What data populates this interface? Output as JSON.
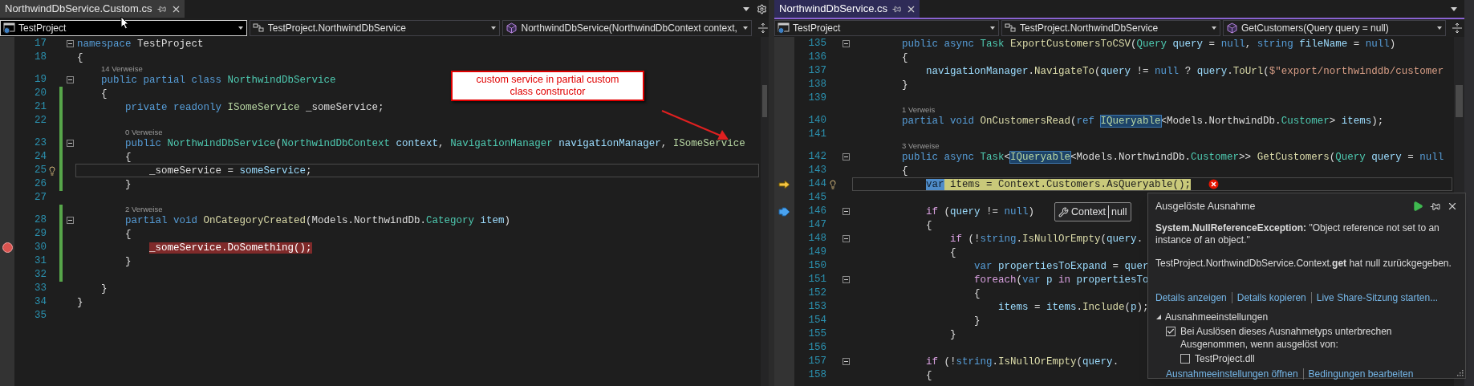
{
  "left_pane": {
    "tab": {
      "title": "NorthwindDbService.Custom.cs",
      "selected": false
    },
    "navigation": [
      {
        "label": "TestProject",
        "focused": true
      },
      {
        "label": "TestProject.NorthwindDbService",
        "focused": false
      },
      {
        "label": "NorthwindDbService(NorthwindDbContext context,",
        "focused": false
      }
    ],
    "annotation": {
      "text": "custom service in partial custom class constructor"
    },
    "lines": [
      {
        "kind": "code",
        "number": "17",
        "tokens": [
          {
            "text": "namespace",
            "kind": "kw"
          },
          {
            "text": " TestProject",
            "kind": "plain"
          }
        ],
        "changed": false,
        "fold": true,
        "caret_line": false
      },
      {
        "kind": "code",
        "number": "18",
        "tokens": [
          {
            "text": "{",
            "kind": "plain"
          }
        ],
        "changed": false,
        "fold": false,
        "caret_line": false
      },
      {
        "kind": "lens",
        "text": "14 Verweise",
        "changed": false
      },
      {
        "kind": "code",
        "number": "19",
        "tokens": [
          {
            "text": "    public partial class",
            "kind": "kw"
          },
          {
            "text": " NorthwindDbService",
            "kind": "type"
          }
        ],
        "changed": false,
        "fold": true,
        "caret_line": false
      },
      {
        "kind": "code",
        "number": "20",
        "tokens": [
          {
            "text": "    {",
            "kind": "plain"
          }
        ],
        "changed": true,
        "fold": false,
        "caret_line": false
      },
      {
        "kind": "code",
        "number": "21",
        "tokens": [
          {
            "text": "        private readonly",
            "kind": "kw"
          },
          {
            "text": " ISomeService",
            "kind": "iface"
          },
          {
            "text": " _someService;",
            "kind": "plain"
          }
        ],
        "changed": true,
        "fold": false,
        "caret_line": false
      },
      {
        "kind": "code",
        "number": "22",
        "changed": true,
        "fold": false,
        "caret_line": false
      },
      {
        "kind": "lens",
        "text": "0 Verweise",
        "changed": true
      },
      {
        "kind": "code",
        "number": "23",
        "tokens": [
          {
            "text": "        public",
            "kind": "kw"
          },
          {
            "text": " NorthwindDbService",
            "kind": "type"
          },
          {
            "text": "(",
            "kind": "plain"
          },
          {
            "text": "NorthwindDbContext",
            "kind": "type"
          },
          {
            "text": " context",
            "kind": "param"
          },
          {
            "text": ", ",
            "kind": "plain"
          },
          {
            "text": "NavigationManager",
            "kind": "type"
          },
          {
            "text": " navigationManager",
            "kind": "param"
          },
          {
            "text": ", ",
            "kind": "plain"
          },
          {
            "text": "ISomeService",
            "kind": "iface"
          }
        ],
        "changed": true,
        "fold": true,
        "caret_line": false
      },
      {
        "kind": "code",
        "number": "24",
        "tokens": [
          {
            "text": "        {",
            "kind": "plain"
          }
        ],
        "changed": true,
        "fold": false,
        "caret_line": false
      },
      {
        "kind": "code",
        "number": "25",
        "tokens": [
          {
            "text": "            _someService = ",
            "kind": "plain"
          },
          {
            "text": "someService",
            "kind": "param"
          },
          {
            "text": ";",
            "kind": "plain"
          }
        ],
        "changed": true,
        "fold": false,
        "caret_line": true
      },
      {
        "kind": "code",
        "number": "26",
        "tokens": [
          {
            "text": "        }",
            "kind": "plain"
          }
        ],
        "changed": true,
        "fold": false,
        "caret_line": false
      },
      {
        "kind": "code",
        "number": "27",
        "changed": false,
        "fold": false,
        "caret_line": false
      },
      {
        "kind": "lens",
        "text": "2 Verweise",
        "changed": true
      },
      {
        "kind": "code",
        "number": "28",
        "tokens": [
          {
            "text": "        partial void",
            "kind": "kw"
          },
          {
            "text": " OnCategoryCreated",
            "kind": "method"
          },
          {
            "text": "(Models.NorthwindDb.",
            "kind": "plain"
          },
          {
            "text": "Category",
            "kind": "type"
          },
          {
            "text": " item",
            "kind": "param"
          },
          {
            "text": ")",
            "kind": "plain"
          }
        ],
        "changed": true,
        "fold": true,
        "caret_line": false
      },
      {
        "kind": "code",
        "number": "29",
        "tokens": [
          {
            "text": "        {",
            "kind": "plain"
          }
        ],
        "changed": true,
        "fold": false,
        "caret_line": false
      },
      {
        "kind": "code",
        "number": "30",
        "tokens": [
          {
            "text": "            _someService.DoSomething();",
            "kind": "bp"
          }
        ],
        "changed": true,
        "fold": false,
        "caret_line": false,
        "marker": {
          "kind": "breakpoint"
        }
      },
      {
        "kind": "code",
        "number": "31",
        "tokens": [
          {
            "text": "        }",
            "kind": "plain"
          }
        ],
        "changed": true,
        "fold": false,
        "caret_line": false
      },
      {
        "kind": "code",
        "number": "32",
        "changed": true,
        "fold": false,
        "caret_line": false
      },
      {
        "kind": "code",
        "number": "33",
        "tokens": [
          {
            "text": "    }",
            "kind": "plain"
          }
        ],
        "changed": false,
        "fold": false,
        "caret_line": false
      },
      {
        "kind": "code",
        "number": "34",
        "tokens": [
          {
            "text": "}",
            "kind": "plain"
          }
        ],
        "changed": false,
        "fold": false,
        "caret_line": false
      },
      {
        "kind": "code",
        "number": "35",
        "changed": false,
        "fold": false,
        "caret_line": false
      }
    ]
  },
  "right_pane": {
    "tab": {
      "title": "NorthwindDbService.cs",
      "selected": true
    },
    "navigation": [
      {
        "label": "TestProject",
        "focused": false
      },
      {
        "label": "TestProject.NorthwindDbService",
        "focused": false
      },
      {
        "label": "GetCustomers(Query query = null)",
        "focused": false
      }
    ],
    "datatip": {
      "name": "Context",
      "value": "null"
    },
    "lines": [
      {
        "kind": "code",
        "number": "135",
        "tokens": [
          {
            "text": "        public async",
            "kind": "kw"
          },
          {
            "text": " Task",
            "kind": "type"
          },
          {
            "text": " ExportCustomersToCSV",
            "kind": "method"
          },
          {
            "text": "(",
            "kind": "plain"
          },
          {
            "text": "Query",
            "kind": "type"
          },
          {
            "text": " query",
            "kind": "param"
          },
          {
            "text": " = ",
            "kind": "plain"
          },
          {
            "text": "null",
            "kind": "kw"
          },
          {
            "text": ", ",
            "kind": "plain"
          },
          {
            "text": "string",
            "kind": "kw"
          },
          {
            "text": " fileName",
            "kind": "param"
          },
          {
            "text": " = ",
            "kind": "plain"
          },
          {
            "text": "null",
            "kind": "kw"
          },
          {
            "text": ")",
            "kind": "plain"
          }
        ],
        "fold": true,
        "caret_line": false
      },
      {
        "kind": "code",
        "number": "136",
        "tokens": [
          {
            "text": "        {",
            "kind": "plain"
          }
        ],
        "fold": false,
        "caret_line": false
      },
      {
        "kind": "code",
        "number": "137",
        "tokens": [
          {
            "text": "            navigationManager",
            "kind": "param"
          },
          {
            "text": ".",
            "kind": "plain"
          },
          {
            "text": "NavigateTo",
            "kind": "method"
          },
          {
            "text": "(",
            "kind": "plain"
          },
          {
            "text": "query",
            "kind": "param"
          },
          {
            "text": " != ",
            "kind": "plain"
          },
          {
            "text": "null",
            "kind": "kw"
          },
          {
            "text": " ? ",
            "kind": "plain"
          },
          {
            "text": "query",
            "kind": "param"
          },
          {
            "text": ".",
            "kind": "plain"
          },
          {
            "text": "ToUrl",
            "kind": "method"
          },
          {
            "text": "(",
            "kind": "plain"
          },
          {
            "text": "$\"export/northwinddb/customer",
            "kind": "str"
          }
        ],
        "fold": false,
        "caret_line": false
      },
      {
        "kind": "code",
        "number": "138",
        "tokens": [
          {
            "text": "        }",
            "kind": "plain"
          }
        ],
        "fold": false,
        "caret_line": false
      },
      {
        "kind": "code",
        "number": "139",
        "fold": false,
        "caret_line": false
      },
      {
        "kind": "lens",
        "text": "1 Verweis"
      },
      {
        "kind": "code",
        "number": "140",
        "tokens": [
          {
            "text": "        partial void",
            "kind": "kw"
          },
          {
            "text": " OnCustomersRead",
            "kind": "method"
          },
          {
            "text": "(",
            "kind": "plain"
          },
          {
            "text": "ref ",
            "kind": "kw"
          },
          {
            "text": "IQueryable",
            "kind": "ref"
          },
          {
            "text": "<Models.NorthwindDb.",
            "kind": "plain"
          },
          {
            "text": "Customer",
            "kind": "type"
          },
          {
            "text": "> ",
            "kind": "plain"
          },
          {
            "text": "items",
            "kind": "param"
          },
          {
            "text": ");",
            "kind": "plain"
          }
        ],
        "fold": false,
        "caret_line": false
      },
      {
        "kind": "code",
        "number": "141",
        "fold": false,
        "caret_line": false
      },
      {
        "kind": "lens",
        "text": "3 Verweise"
      },
      {
        "kind": "code",
        "number": "142",
        "tokens": [
          {
            "text": "        public async",
            "kind": "kw"
          },
          {
            "text": " Task",
            "kind": "type"
          },
          {
            "text": "<",
            "kind": "plain"
          },
          {
            "text": "IQueryable",
            "kind": "ref"
          },
          {
            "text": "<Models.NorthwindDb.",
            "kind": "plain"
          },
          {
            "text": "Customer",
            "kind": "type"
          },
          {
            "text": ">> ",
            "kind": "plain"
          },
          {
            "text": "GetCustomers",
            "kind": "method"
          },
          {
            "text": "(",
            "kind": "plain"
          },
          {
            "text": "Query",
            "kind": "type"
          },
          {
            "text": " query",
            "kind": "param"
          },
          {
            "text": " = ",
            "kind": "plain"
          },
          {
            "text": "null",
            "kind": "kw"
          }
        ],
        "fold": true,
        "caret_line": false
      },
      {
        "kind": "code",
        "number": "143",
        "tokens": [
          {
            "text": "        {",
            "kind": "plain"
          }
        ],
        "fold": false,
        "caret_line": false
      },
      {
        "kind": "code",
        "number": "144",
        "tokens": [
          {
            "text": "            var",
            "kind": "curref"
          },
          {
            "text": " items = Context.Customers.AsQueryable();",
            "kind": "cur"
          }
        ],
        "fold": false,
        "caret_line": true,
        "marker": {
          "kind": "current_statement"
        },
        "error": true
      },
      {
        "kind": "code",
        "number": "145",
        "fold": false,
        "caret_line": false
      },
      {
        "kind": "code",
        "number": "146",
        "tokens": [
          {
            "text": "            if",
            "kind": "ctrl"
          },
          {
            "text": " (",
            "kind": "plain"
          },
          {
            "text": "query",
            "kind": "param"
          },
          {
            "text": " != ",
            "kind": "plain"
          },
          {
            "text": "null",
            "kind": "kw"
          },
          {
            "text": ")",
            "kind": "plain"
          }
        ],
        "fold": true,
        "caret_line": false,
        "marker": {
          "kind": "step_marker"
        }
      },
      {
        "kind": "code",
        "number": "147",
        "tokens": [
          {
            "text": "            {",
            "kind": "plain"
          }
        ],
        "fold": false,
        "caret_line": false
      },
      {
        "kind": "code",
        "number": "148",
        "tokens": [
          {
            "text": "                if",
            "kind": "ctrl"
          },
          {
            "text": " (!",
            "kind": "plain"
          },
          {
            "text": "string",
            "kind": "kw"
          },
          {
            "text": ".",
            "kind": "plain"
          },
          {
            "text": "IsNullOrEmpty",
            "kind": "method"
          },
          {
            "text": "(",
            "kind": "plain"
          },
          {
            "text": "query",
            "kind": "param"
          },
          {
            "text": ".",
            "kind": "plain"
          }
        ],
        "fold": true,
        "caret_line": false
      },
      {
        "kind": "code",
        "number": "149",
        "tokens": [
          {
            "text": "                {",
            "kind": "plain"
          }
        ],
        "fold": false,
        "caret_line": false
      },
      {
        "kind": "code",
        "number": "150",
        "tokens": [
          {
            "text": "                    var",
            "kind": "kw"
          },
          {
            "text": " propertiesToExpand",
            "kind": "param"
          },
          {
            "text": " = ",
            "kind": "plain"
          },
          {
            "text": "quer",
            "kind": "param"
          }
        ],
        "fold": false,
        "caret_line": false
      },
      {
        "kind": "code",
        "number": "151",
        "tokens": [
          {
            "text": "                    foreach",
            "kind": "ctrl"
          },
          {
            "text": "(",
            "kind": "plain"
          },
          {
            "text": "var",
            "kind": "kw"
          },
          {
            "text": " p",
            "kind": "param"
          },
          {
            "text": " in",
            "kind": "ctrl"
          },
          {
            "text": " propertiesTo",
            "kind": "param"
          }
        ],
        "fold": true,
        "caret_line": false
      },
      {
        "kind": "code",
        "number": "152",
        "tokens": [
          {
            "text": "                    {",
            "kind": "plain"
          }
        ],
        "fold": false,
        "caret_line": false
      },
      {
        "kind": "code",
        "number": "153",
        "tokens": [
          {
            "text": "                        items",
            "kind": "param"
          },
          {
            "text": " = ",
            "kind": "plain"
          },
          {
            "text": "items",
            "kind": "param"
          },
          {
            "text": ".",
            "kind": "plain"
          },
          {
            "text": "Include",
            "kind": "method"
          },
          {
            "text": "(",
            "kind": "plain"
          },
          {
            "text": "p",
            "kind": "param"
          },
          {
            "text": ");",
            "kind": "plain"
          }
        ],
        "fold": false,
        "caret_line": false
      },
      {
        "kind": "code",
        "number": "154",
        "tokens": [
          {
            "text": "                    }",
            "kind": "plain"
          }
        ],
        "fold": false,
        "caret_line": false
      },
      {
        "kind": "code",
        "number": "155",
        "tokens": [
          {
            "text": "                }",
            "kind": "plain"
          }
        ],
        "fold": false,
        "caret_line": false
      },
      {
        "kind": "code",
        "number": "156",
        "fold": false,
        "caret_line": false
      },
      {
        "kind": "code",
        "number": "157",
        "tokens": [
          {
            "text": "            if",
            "kind": "ctrl"
          },
          {
            "text": " (!",
            "kind": "plain"
          },
          {
            "text": "string",
            "kind": "kw"
          },
          {
            "text": ".",
            "kind": "plain"
          },
          {
            "text": "IsNullOrEmpty",
            "kind": "method"
          },
          {
            "text": "(",
            "kind": "plain"
          },
          {
            "text": "query",
            "kind": "param"
          },
          {
            "text": ".",
            "kind": "plain"
          }
        ],
        "fold": true,
        "caret_line": false
      },
      {
        "kind": "code",
        "number": "158",
        "tokens": [
          {
            "text": "            {",
            "kind": "plain"
          }
        ],
        "fold": false,
        "caret_line": false
      }
    ]
  },
  "exception_popup": {
    "title": "Ausgelöste Ausnahme",
    "message": "**System.NullReferenceException:** \"Object reference not set to an instance of an object.\"",
    "detail": "TestProject.NorthwindDbService.Context.**get** hat null zurückgegeben.",
    "links": [
      "Details anzeigen",
      "Details kopieren",
      "Live Share-Sitzung starten..."
    ],
    "settings": {
      "title": "Ausnahmeeinstellungen",
      "expanded": true,
      "break_option": {
        "label": "Bei Auslösen dieses Ausnahmetyps unterbrechen",
        "checked": true
      },
      "exceptions_label": "Ausgenommen, wenn ausgelöst von:",
      "exceptions": [
        {
          "label": "TestProject.dll",
          "checked": false
        }
      ]
    },
    "footer_links": [
      "Ausnahmeeinstellungen öffnen",
      "Bedingungen bearbeiten"
    ]
  }
}
